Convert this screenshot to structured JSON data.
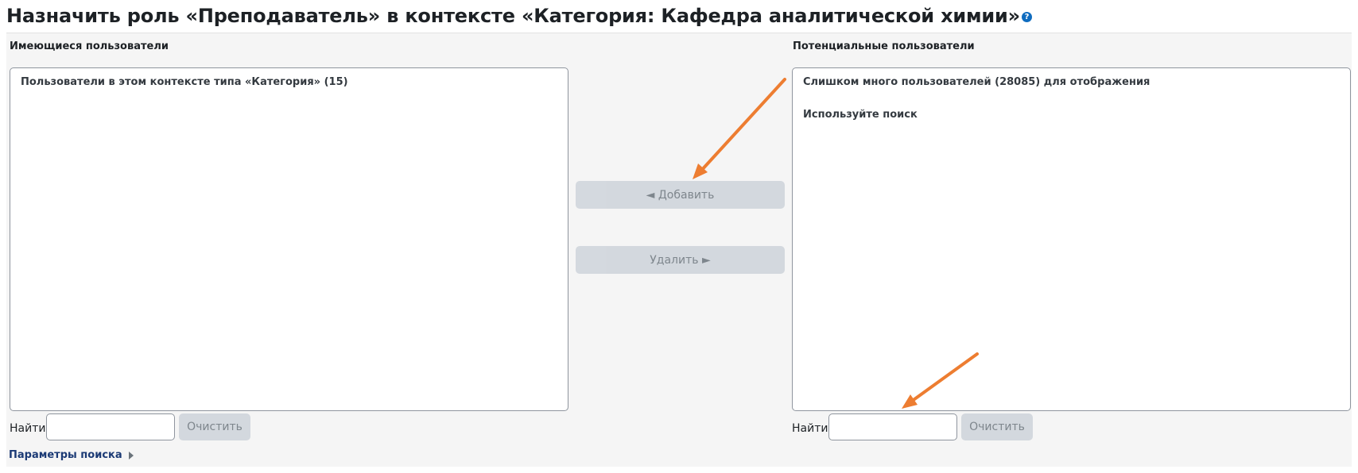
{
  "page": {
    "title": "Назначить роль «Преподаватель» в контексте «Категория: Кафедра аналитической химии»",
    "help_icon_glyph": "?"
  },
  "existing": {
    "title": "Имеющиеся пользователи",
    "group_label": "Пользователи в этом контексте типа «Категория» (15)",
    "find_label": "Найти",
    "find_value": "",
    "clear_label": "Очистить"
  },
  "actions": {
    "add_label": "◄ Добавить",
    "remove_label": "Удалить ►"
  },
  "potential": {
    "title": "Потенциальные пользователи",
    "too_many": "Слишком много пользователей (28085) для отображения",
    "use_search": "Используйте поиск",
    "find_label": "Найти",
    "find_value": "",
    "clear_label": "Очистить"
  },
  "search_options": {
    "label": "Параметры поиска"
  },
  "colors": {
    "annotation_arrow": "#ed7d31",
    "link": "#1b3a75",
    "help": "#0f6cbf"
  }
}
